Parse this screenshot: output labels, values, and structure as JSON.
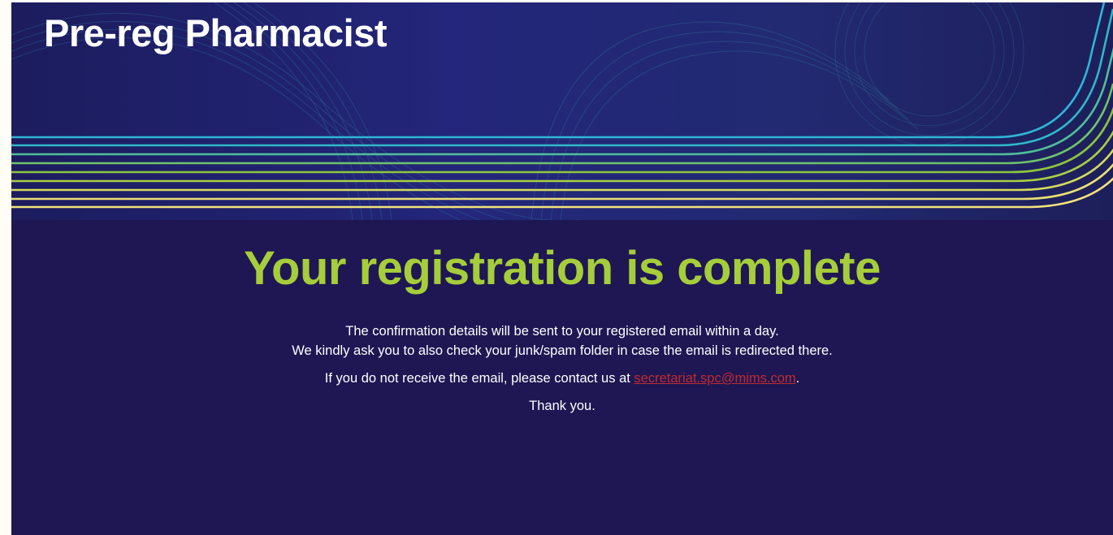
{
  "header": {
    "title": "Pre-reg Pharmacist"
  },
  "confirmation": {
    "heading": "Your registration is complete",
    "line1": "The confirmation details will be sent to your registered email within a day.",
    "line2": "We kindly ask you to also check your junk/spam folder in case the email is redirected there.",
    "contact_prefix": "If you do not receive the email, please contact us at ",
    "contact_email": "secretariat.spc@mims.com",
    "contact_suffix": ".",
    "thanks": "Thank you."
  },
  "colors": {
    "page_background": "#1e1753",
    "heading_green": "#a6cd3a",
    "link_red": "#c12a2f",
    "line_cyan": "#2fb5d6",
    "line_green": "#8cc63f",
    "line_yellow": "#f3e37c"
  }
}
